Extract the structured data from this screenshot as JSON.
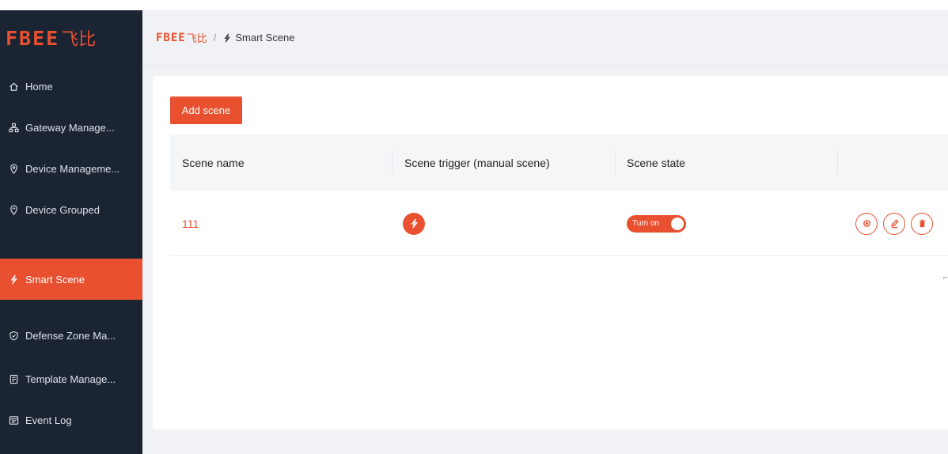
{
  "brand": {
    "latin": "FBEE",
    "cn": "飞比"
  },
  "colors": {
    "accent": "#e8502f",
    "sidebar_bg": "#1b2433"
  },
  "sidebar": {
    "items": [
      {
        "label": "Home",
        "icon": "home-icon",
        "active": false
      },
      {
        "label": "Gateway Manage...",
        "icon": "gateway-icon",
        "active": false
      },
      {
        "label": "Device Manageme...",
        "icon": "location-pin-icon",
        "active": false
      },
      {
        "label": "Device Grouped",
        "icon": "group-pin-icon",
        "active": false
      },
      {
        "label": "Smart Scene",
        "icon": "lightning-icon",
        "active": true
      },
      {
        "label": "Defense Zone Ma...",
        "icon": "shield-icon",
        "active": false
      },
      {
        "label": "Template Manage...",
        "icon": "template-icon",
        "active": false
      },
      {
        "label": "Event Log",
        "icon": "event-log-icon",
        "active": false
      }
    ]
  },
  "breadcrumb": {
    "separator": "/",
    "current": "Smart Scene"
  },
  "main": {
    "add_button": "Add scene",
    "columns": [
      "Scene name",
      "Scene trigger (manual scene)",
      "Scene state"
    ],
    "rows": [
      {
        "name": "111",
        "state_label": "Turn on",
        "state_on": true
      }
    ]
  }
}
